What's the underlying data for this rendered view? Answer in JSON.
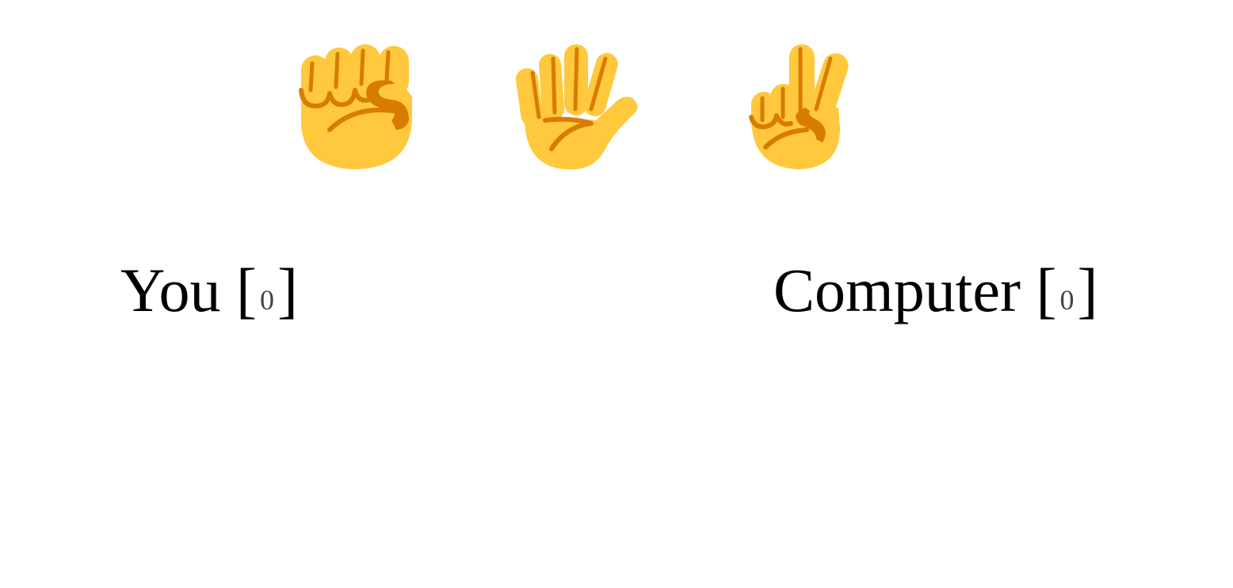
{
  "choices": [
    {
      "id": "rock",
      "icon": "raised-fist-icon"
    },
    {
      "id": "paper",
      "icon": "raised-hand-icon"
    },
    {
      "id": "scissors",
      "icon": "victory-hand-icon"
    }
  ],
  "colors": {
    "skin": "#FFC83D",
    "shade": "#D87C00",
    "text": "#000000",
    "score": "#444444"
  },
  "player": {
    "label": "You",
    "score": "0"
  },
  "computer": {
    "label": "Computer",
    "score": "0"
  }
}
